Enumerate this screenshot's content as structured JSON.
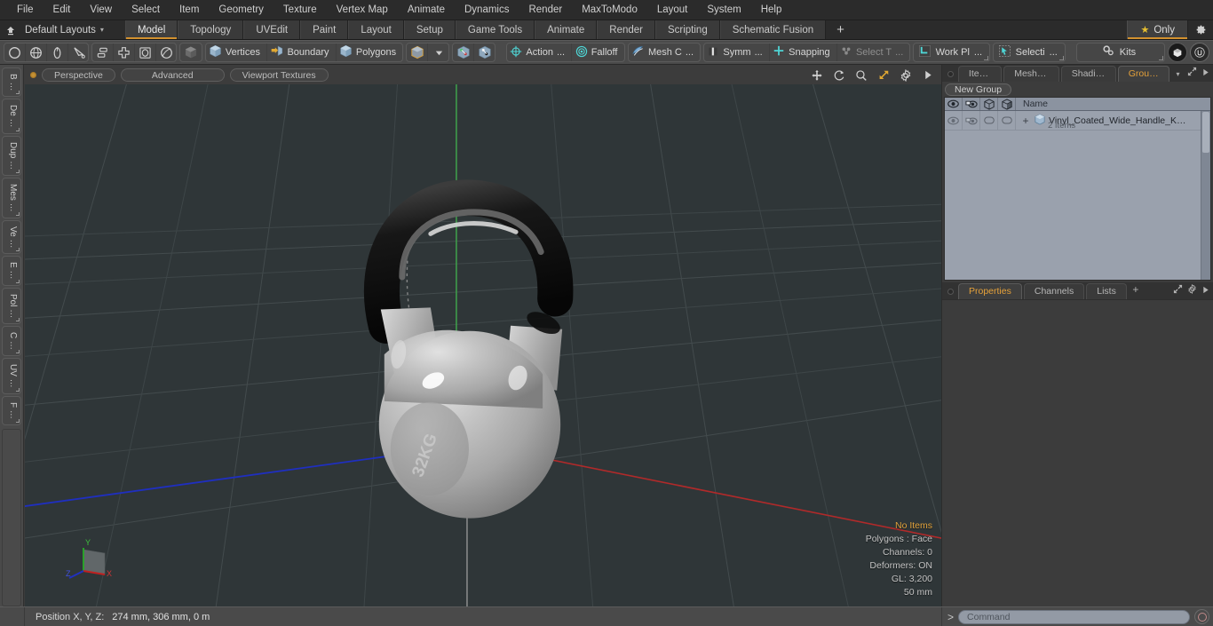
{
  "app": {
    "title": "Modo",
    "accent_orange": "#d2912f",
    "panel_bg": "#3c3c3c",
    "viewport_bg": "#2f3638"
  },
  "menubar": {
    "items": [
      {
        "label": "File"
      },
      {
        "label": "Edit"
      },
      {
        "label": "View"
      },
      {
        "label": "Select"
      },
      {
        "label": "Item"
      },
      {
        "label": "Geometry"
      },
      {
        "label": "Texture"
      },
      {
        "label": "Vertex Map"
      },
      {
        "label": "Animate"
      },
      {
        "label": "Dynamics"
      },
      {
        "label": "Render"
      },
      {
        "label": "MaxToModo"
      },
      {
        "label": "Layout"
      },
      {
        "label": "System"
      },
      {
        "label": "Help"
      }
    ]
  },
  "layoutbar": {
    "home_icon": "home-up-arrow-icon",
    "layouts_label": "Default Layouts",
    "caret": "▾",
    "tabs": [
      {
        "label": "Model",
        "active": true
      },
      {
        "label": "Topology",
        "active": false
      },
      {
        "label": "UVEdit",
        "active": false
      },
      {
        "label": "Paint",
        "active": false
      },
      {
        "label": "Layout",
        "active": false
      },
      {
        "label": "Setup",
        "active": false
      },
      {
        "label": "Game Tools",
        "active": false
      },
      {
        "label": "Animate",
        "active": false
      },
      {
        "label": "Render",
        "active": false
      },
      {
        "label": "Scripting",
        "active": false
      },
      {
        "label": "Schematic Fusion",
        "active": false
      }
    ],
    "plus": "+",
    "only_label": "Only",
    "star": "★",
    "gear_icon": "gear-icon"
  },
  "toolbar": {
    "group_primitives": [
      {
        "icon": "circle-icon",
        "name": "circle-tool"
      },
      {
        "icon": "globe-icon",
        "name": "globe-tool"
      },
      {
        "icon": "cone-icon",
        "name": "cone-tool"
      },
      {
        "icon": "curve-icon",
        "name": "curve-tool"
      }
    ],
    "group_arrange": [
      {
        "icon": "align-icon",
        "name": "align-tool"
      },
      {
        "icon": "plus-box-icon",
        "name": "center-tool"
      },
      {
        "icon": "square-in-box-icon",
        "name": "bevel-tool"
      },
      {
        "icon": "sphere-outline-icon",
        "name": "round-tool"
      }
    ],
    "group_mode_cube": {
      "icon": "cube-dark-icon",
      "name": "items-mode"
    },
    "group_components": [
      {
        "icon": "cube-blue-icon",
        "label": "Vertices",
        "name": "vertices-mode"
      },
      {
        "icon": "cube-arrow-icon",
        "label": "Boundary",
        "name": "boundary-mode"
      },
      {
        "icon": "cube-blue-icon",
        "label": "Polygons",
        "name": "polygons-mode"
      }
    ],
    "group_cube_drop": {
      "icon": "cube-gold-icon",
      "caret": "▾",
      "name": "selection-mode-dropdown"
    },
    "group_axis_icons": [
      {
        "icon": "axis-gizmo-green-icon",
        "name": "axis-gizmo-a"
      },
      {
        "icon": "axis-gizmo-white-icon",
        "name": "axis-gizmo-b"
      }
    ],
    "group_action": [
      {
        "icon": "target-crosshair-icon",
        "label": "Action",
        "sub": "...",
        "name": "action-center"
      },
      {
        "icon": "falloff-circle-icon",
        "label": "Falloff",
        "name": "falloff"
      }
    ],
    "group_meshc": {
      "icon": "mesh-ribbon-icon",
      "label": "Mesh C",
      "sub": "...",
      "name": "mesh-constraint"
    },
    "group_symm": [
      {
        "icon": "symmetry-bars-icon",
        "label": "Symm",
        "sub": "...",
        "name": "symmetry"
      },
      {
        "icon": "snapping-cross-icon",
        "label": "Snapping",
        "name": "snapping"
      },
      {
        "icon": "select-through-icon",
        "label": "Select T",
        "sub": "...",
        "name": "select-through",
        "dim": true
      }
    ],
    "group_workplane": {
      "icon": "work-plane-icon",
      "label": "Work Pl",
      "sub": "...",
      "name": "work-plane"
    },
    "group_selection": {
      "icon": "selection-set-icon",
      "label": "Selecti",
      "sub": "...",
      "name": "selection-sets"
    },
    "group_kits": {
      "icon": "gears-icon",
      "label": "Kits",
      "name": "kits"
    },
    "group_logos": [
      {
        "icon": "modo-logo-icon",
        "name": "modo-logo"
      },
      {
        "icon": "unreal-logo-icon",
        "name": "unreal-logo"
      }
    ]
  },
  "left_strip": {
    "tabs": [
      {
        "label": "B …"
      },
      {
        "label": "De …"
      },
      {
        "label": "Dup …"
      },
      {
        "label": "Mes …"
      },
      {
        "label": "Ve …"
      },
      {
        "label": "E …"
      },
      {
        "label": "Pol …"
      },
      {
        "label": "C …"
      },
      {
        "label": "UV …"
      },
      {
        "label": "F …"
      }
    ]
  },
  "viewport": {
    "pills": [
      {
        "label": "Perspective",
        "name": "viewport-view-mode"
      },
      {
        "label": "Advanced",
        "name": "viewport-shading-mode"
      },
      {
        "label": "Viewport Textures",
        "name": "viewport-textures"
      }
    ],
    "icons": [
      {
        "icon": "move-arrows-icon",
        "name": "viewport-pan"
      },
      {
        "icon": "rotate-icon",
        "name": "viewport-rotate"
      },
      {
        "icon": "magnifier-icon",
        "name": "viewport-zoom"
      },
      {
        "icon": "fit-diagonal-icon",
        "name": "viewport-fit"
      },
      {
        "icon": "gear-icon",
        "name": "viewport-options"
      },
      {
        "icon": "play-triangle-icon",
        "name": "viewport-more"
      }
    ],
    "stats": [
      {
        "label": "No Items",
        "highlight": true
      },
      {
        "label": "Polygons : Face",
        "highlight": false
      },
      {
        "label": "Channels: 0",
        "highlight": false
      },
      {
        "label": "Deformers: ON",
        "highlight": false
      },
      {
        "label": "GL: 3,200",
        "highlight": false
      },
      {
        "label": "50 mm",
        "highlight": false
      }
    ],
    "axis_gizmo": {
      "x": "X",
      "y": "Y",
      "z": "Z",
      "x_color": "#c02020",
      "y_color": "#2aa02a",
      "z_color": "#2030c0"
    },
    "model": {
      "name": "kettlebell",
      "face_text": "32KG",
      "ball_color": "#b5b5b5",
      "handle_color": "#141414"
    }
  },
  "right_panel": {
    "top_tabs": [
      {
        "label": "Items",
        "active": false
      },
      {
        "label": "Mesh …",
        "active": false
      },
      {
        "label": "Shading",
        "active": false
      },
      {
        "label": "Groups",
        "active": true
      }
    ],
    "top_caret": "▾",
    "new_group_label": "New Group",
    "tree": {
      "columns": [
        {
          "icon": "eye-icon",
          "name": "visibility-column"
        },
        {
          "icon": "render-eye-icon",
          "name": "render-visibility-column"
        },
        {
          "icon": "cube-outline-icon",
          "name": "lock-column"
        },
        {
          "icon": "cube-solid-icon",
          "name": "wireframe-column"
        }
      ],
      "name_header": "Name",
      "rows": [
        {
          "expander": "+",
          "icon": "mesh-item-icon",
          "label": "Vinyl_Coated_Wide_Handle_K…",
          "sub": "2 Items"
        }
      ]
    },
    "bottom_tabs": [
      {
        "label": "Properties",
        "active": true
      },
      {
        "label": "Channels",
        "active": false
      },
      {
        "label": "Lists",
        "active": false
      }
    ],
    "bottom_plus": "+"
  },
  "statusbar": {
    "position_label": "Position X, Y, Z:",
    "position_value": "274 mm, 306 mm, 0 m",
    "command_prompt": ">",
    "command_placeholder": "Command",
    "command_value": "",
    "command_button_icon": "record-circle-icon"
  }
}
